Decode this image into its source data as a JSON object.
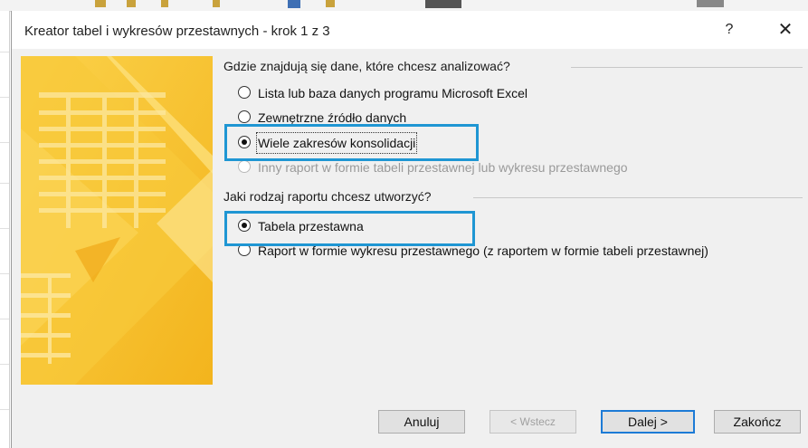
{
  "window": {
    "title": "Kreator tabel i wykresów przestawnych - krok 1 z 3",
    "help_glyph": "?",
    "close_glyph": "✕"
  },
  "source_group": {
    "legend": "Gdzie znajdują się dane, które chcesz analizować?",
    "options": [
      {
        "label": "Lista lub baza danych programu Microsoft Excel",
        "checked": false,
        "disabled": false
      },
      {
        "label": "Zewnętrzne źródło danych",
        "checked": false,
        "disabled": false
      },
      {
        "label": "Wiele zakresów konsolidacji",
        "checked": true,
        "disabled": false
      },
      {
        "label": "Inny raport w formie tabeli przestawnej lub wykresu przestawnego",
        "checked": false,
        "disabled": true
      }
    ]
  },
  "report_group": {
    "legend": "Jaki rodzaj raportu chcesz utworzyć?",
    "options": [
      {
        "label": "Tabela przestawna",
        "checked": true,
        "disabled": false
      },
      {
        "label": "Raport w formie wykresu przestawnego (z raportem w formie tabeli przestawnej)",
        "checked": false,
        "disabled": false
      }
    ]
  },
  "buttons": {
    "cancel": "Anuluj",
    "back": "< Wstecz",
    "next": "Dalej >",
    "finish": "Zakończ"
  },
  "colors": {
    "highlight": "#1f96d3",
    "illustration_yellow": "#f7c534",
    "default_button_border": "#1d7bd6"
  }
}
